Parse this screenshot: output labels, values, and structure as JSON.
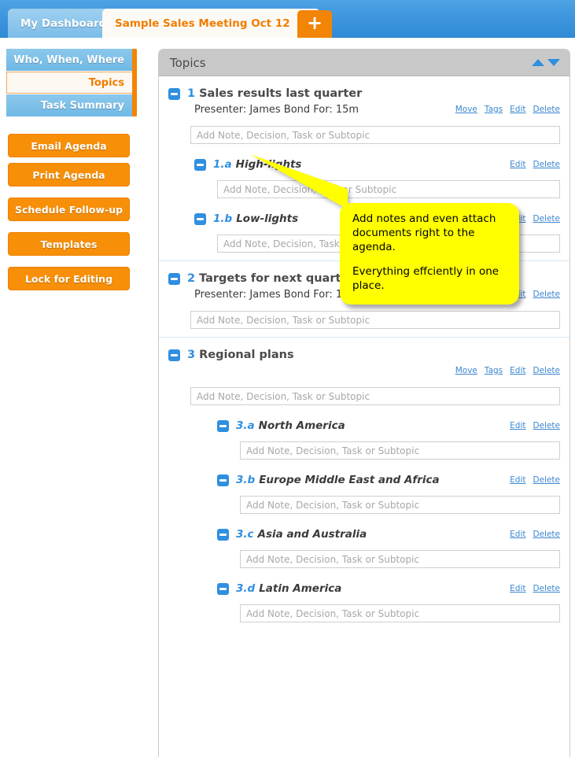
{
  "tabbar": {
    "dashboard_tab": "My Dashboard",
    "active_tab": "Sample Sales Meeting Oct 12",
    "close_icon": "✖",
    "add_icon": "+"
  },
  "sidebar": {
    "nav_items": [
      {
        "label": "Who, When, Where",
        "selected": false
      },
      {
        "label": "Topics",
        "selected": true
      },
      {
        "label": "Task Summary",
        "selected": false
      }
    ],
    "buttons": [
      "Email Agenda",
      "Print Agenda",
      "Schedule Follow-up",
      "Templates",
      "Lock for Editing"
    ]
  },
  "panel": {
    "title": "Topics",
    "sort_up_icon": "triangle-up",
    "sort_down_icon": "triangle-down"
  },
  "labels": {
    "note_placeholder": "Add Note, Decision, Task or Subtopic",
    "presenter_prefix": "Presenter:",
    "duration_prefix": "For:",
    "link_move": "Move",
    "link_tags": "Tags",
    "link_edit": "Edit",
    "link_delete": "Delete"
  },
  "topics": [
    {
      "number": "1",
      "title": "Sales results last quarter",
      "presenter_line": "Presenter: James Bond For: 15m",
      "has_presenter": true,
      "subtopics": [
        {
          "number": "1.a",
          "title": "High-lights"
        },
        {
          "number": "1.b",
          "title": "Low-lights"
        }
      ]
    },
    {
      "number": "2",
      "title": "Targets for next quarter",
      "presenter_line": "Presenter: James Bond For: 15m",
      "has_presenter": true,
      "subtopics": []
    },
    {
      "number": "3",
      "title": "Regional plans",
      "presenter_line": "",
      "has_presenter": false,
      "subtopics": [
        {
          "number": "3.a",
          "title": "North America"
        },
        {
          "number": "3.b",
          "title": "Europe Middle East and Africa"
        },
        {
          "number": "3.c",
          "title": "Asia and Australia"
        },
        {
          "number": "3.d",
          "title": "Latin America"
        }
      ]
    }
  ],
  "callout": {
    "paragraph_1": "Add notes and even attach documents right to the agenda.",
    "paragraph_2": "Everything effciently in one place."
  },
  "colors": {
    "brand_orange": "#f28406",
    "brand_blue": "#2f8fe0",
    "tabbar_blue": "#3d95dd",
    "callout_yellow": "#ffff00",
    "panel_header_gray": "#c8c8c8"
  }
}
